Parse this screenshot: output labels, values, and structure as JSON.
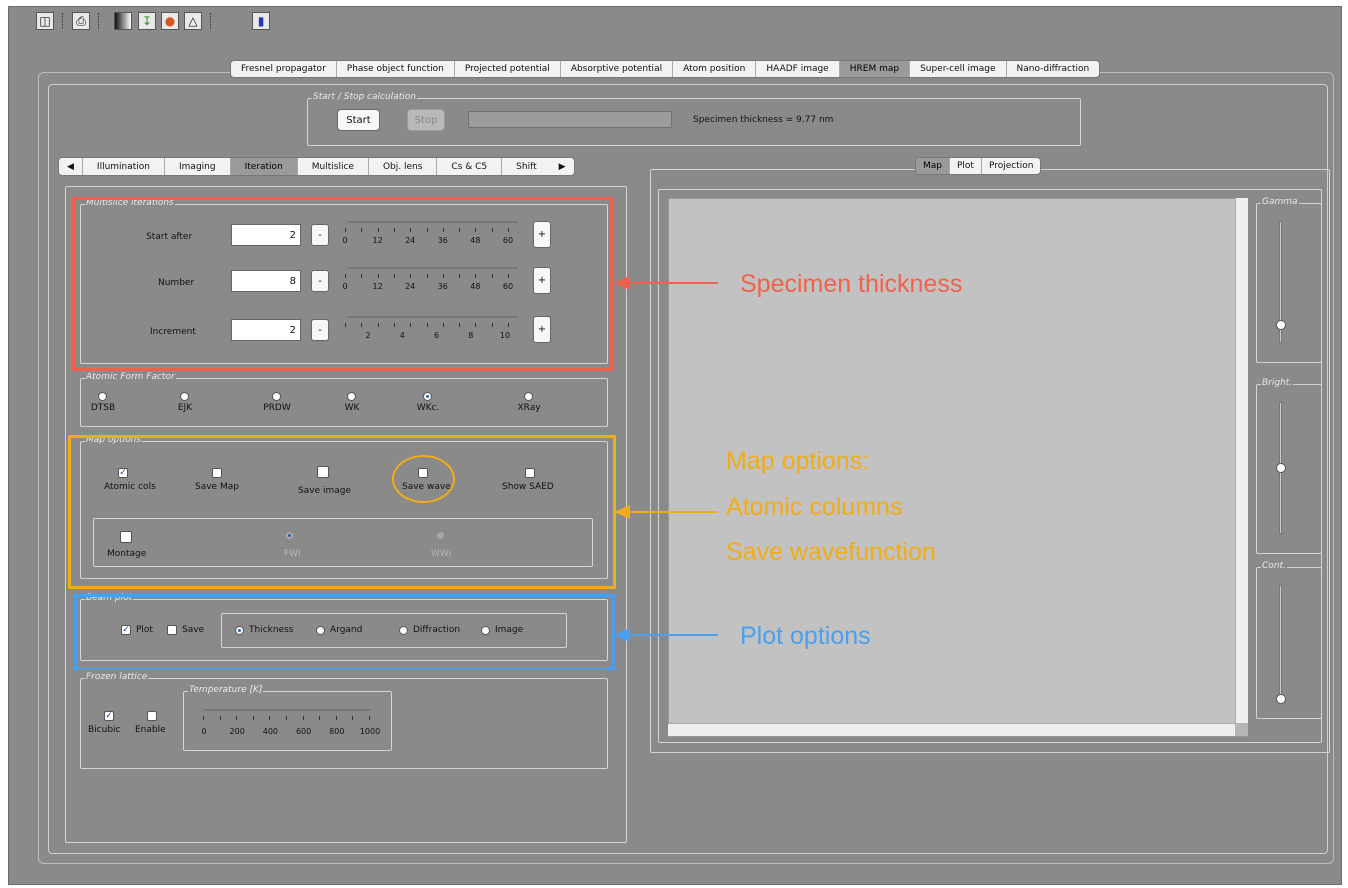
{
  "toolbar": {
    "icons": [
      "save-icon",
      "print-icon",
      "gradient-icon",
      "export-icon",
      "palette-icon",
      "spectrum-icon",
      "book-icon"
    ]
  },
  "main_tabs": [
    "Fresnel propagator",
    "Phase object function",
    "Projected potential",
    "Absorptive potential",
    "Atom position",
    "HAADF image",
    "HREM map",
    "Super-cell image",
    "Nano-diffraction"
  ],
  "main_tab_selected": "HREM map",
  "calc": {
    "group_title": "Start / Stop calculation",
    "start_label": "Start",
    "stop_label": "Stop",
    "progress": 0,
    "thickness_text": "Specimen thickness = 9.77 nm"
  },
  "sub_tabs": [
    "Illumination",
    "Imaging",
    "Iteration",
    "Multislice",
    "Obj. lens",
    "Cs & C5",
    "Shift"
  ],
  "sub_tab_selected": "Iteration",
  "iterations": {
    "title": "Multislice iterations",
    "rows": [
      {
        "label": "Start after",
        "value": "2",
        "ticks": [
          "0",
          "12",
          "24",
          "36",
          "48",
          "60"
        ],
        "minus": "-",
        "plus": "+"
      },
      {
        "label": "Number",
        "value": "8",
        "ticks": [
          "0",
          "12",
          "24",
          "36",
          "48",
          "60"
        ],
        "minus": "-",
        "plus": "+"
      },
      {
        "label": "Increment",
        "value": "2",
        "ticks": [
          "2",
          "4",
          "6",
          "8",
          "10"
        ],
        "minus": "-",
        "plus": "+"
      }
    ]
  },
  "form_factor": {
    "title": "Atomic Form Factor",
    "options": [
      "DTSB",
      "EJK",
      "PRDW",
      "WK",
      "WKc.",
      "XRay"
    ],
    "selected": "WKc."
  },
  "map_options": {
    "title": "Map options",
    "checks": [
      {
        "label": "Atomic cols",
        "checked": true
      },
      {
        "label": "Save Map",
        "checked": false
      },
      {
        "label": "Save image",
        "checked": false
      },
      {
        "label": "Save wave",
        "checked": false
      },
      {
        "label": "Show SAED",
        "checked": false
      }
    ],
    "montage_label": "Montage",
    "fwi_label": "FWI",
    "wwi_label": "WWI"
  },
  "beam_plot": {
    "title": "Beam plot",
    "plot_label": "Plot",
    "plot_checked": true,
    "save_label": "Save",
    "save_checked": false,
    "modes": [
      "Thickness",
      "Argand",
      "Diffraction",
      "Image"
    ],
    "mode_selected": "Thickness"
  },
  "frozen": {
    "title": "Frozen lattice",
    "bicubic_label": "Bicubic",
    "bicubic_checked": true,
    "enable_label": "Enable",
    "enable_checked": false,
    "temp_title": "Temperature [K]",
    "ticks": [
      "0",
      "200",
      "400",
      "600",
      "800",
      "1000"
    ]
  },
  "view_tabs": [
    "Map",
    "Plot",
    "Projection"
  ],
  "view_tab_selected": "Map",
  "side_sliders": [
    {
      "label": "Gamma",
      "level": 0.15
    },
    {
      "label": "Bright.",
      "level": 0.5
    },
    {
      "label": "Cont.",
      "level": 0.0
    }
  ],
  "annotations": {
    "thickness": "Specimen thickness",
    "map_line1": "Map options:",
    "map_line2": "Atomic columns",
    "map_line3": "Save wavefunction",
    "plot": "Plot options"
  },
  "colors": {
    "annot_red": "#f0624d",
    "annot_orange": "#f1ac17",
    "annot_blue": "#4b9ff0",
    "window_gray": "#8a8a8a"
  }
}
